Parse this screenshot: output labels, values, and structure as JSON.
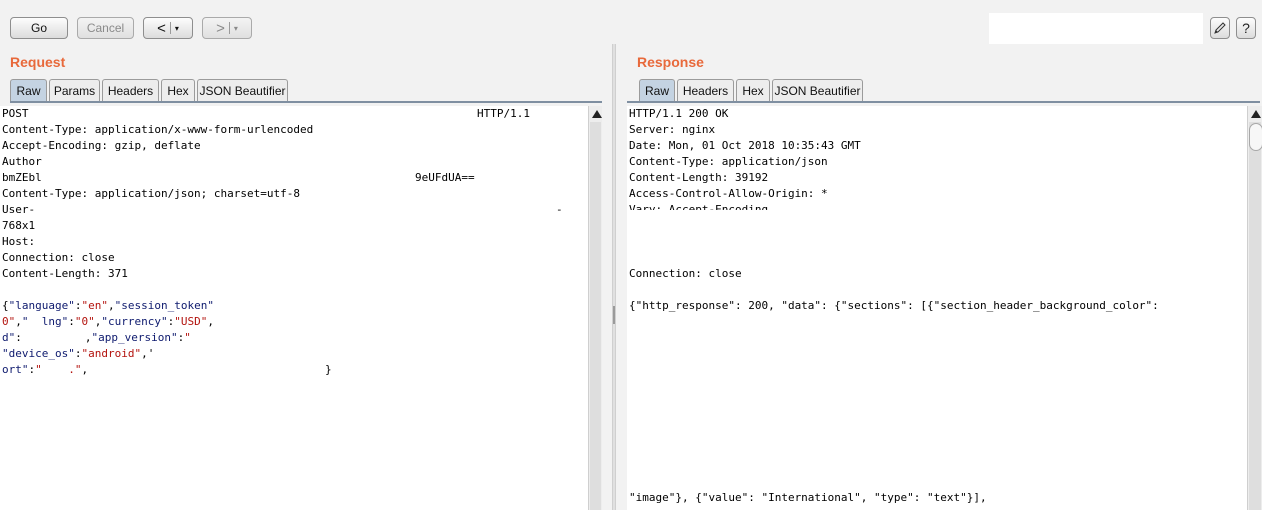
{
  "toolbar": {
    "go_label": "Go",
    "cancel_label": "Cancel",
    "back_glyph": "<",
    "forward_glyph": ">",
    "dropdown_glyph": "▾",
    "help_glyph": "?"
  },
  "request": {
    "title": "Request",
    "tabs": [
      "Raw",
      "Params",
      "Headers",
      "Hex",
      "JSON Beautifier"
    ],
    "active_tab": "Raw",
    "method": "POST",
    "protocol": "HTTP/1.1",
    "headers": [
      "Content-Type: application/x-www-form-urlencoded",
      "Accept-Encoding: gzip, deflate",
      "Author",
      "bmZEbl",
      "Content-Type: application/json; charset=utf-8",
      "User-",
      "768x1",
      "Host:",
      "Connection: close",
      "Content-Length: 371"
    ],
    "auth_tail": "9eUFdUA==",
    "ua_tail": "-",
    "body": {
      "l1": {
        "o1": "{",
        "k1": "\"language\"",
        "c1": ":",
        "v1": "\"en\"",
        "c2": ",",
        "k2": "\"session_token\""
      },
      "l2": {
        "v1": "0\"",
        "c1": ",",
        "k1": "\"  lng\"",
        "c2": ":",
        "v2": "\"0\"",
        "c3": ",",
        "k2": "\"currency\"",
        "c4": ":",
        "v3": "\"USD\"",
        "c5": ","
      },
      "l3": {
        "k1": "d\"",
        "c1": ":",
        "c2": ",",
        "k2": "\"app_version\"",
        "c3": ":",
        "v1": "\""
      },
      "l4": {
        "k1": "\"device_os\"",
        "c1": ":",
        "v1": "\"android\"",
        "c2": ",'"
      },
      "l5": {
        "k1": "ort\"",
        "c1": ":",
        "v1": "\"    .\"",
        "c2": ",",
        "c3": "}"
      }
    }
  },
  "response": {
    "title": "Response",
    "tabs": [
      "Raw",
      "Headers",
      "Hex",
      "JSON Beautifier"
    ],
    "active_tab": "Raw",
    "headers": [
      "HTTP/1.1 200 OK",
      "Server: nginx",
      "Date: Mon, 01 Oct 2018 10:35:43 GMT",
      "Content-Type: application/json",
      "Content-Length: 39192",
      "Access-Control-Allow-Origin: *",
      "Vary: Accept-Encoding"
    ],
    "connection": "Connection: close",
    "body_line1": "{\"http_response\": 200, \"data\": {\"sections\": [{\"section_header_background_color\":",
    "body_line2": "\"image\"}, {\"value\": \"International\", \"type\": \"text\"}],"
  }
}
